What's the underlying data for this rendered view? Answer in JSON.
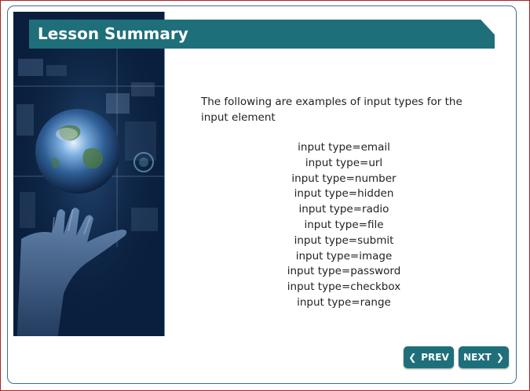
{
  "title": "Lesson Summary",
  "intro_text": "The following are examples of input types for the input element",
  "input_types": [
    "input type=email",
    "input type=url",
    "input type=number",
    "input type=hidden",
    "input type=radio",
    "input type=file",
    "input type=submit",
    "input type=image",
    "input type=password",
    "input type=checkbox",
    "input type=range"
  ],
  "navigation": {
    "prev_label": "PREV",
    "next_label": "NEXT",
    "prev_icon": "chevron-left-icon",
    "next_icon": "chevron-right-icon"
  },
  "colors": {
    "accent": "#1f6f7b",
    "frame_border": "#b01e2a",
    "card_border": "#3a6f98",
    "text": "#222222"
  }
}
